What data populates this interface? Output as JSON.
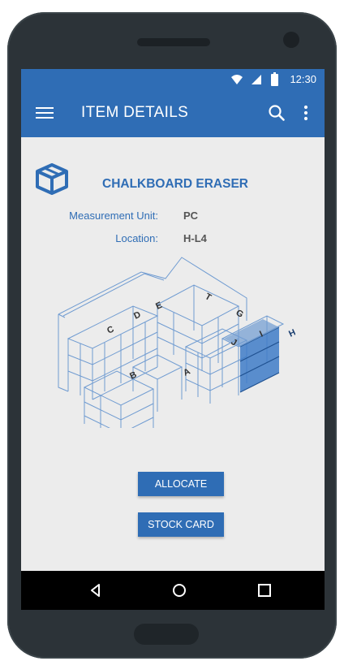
{
  "status": {
    "time": "12:30"
  },
  "appbar": {
    "title": "ITEM DETAILS"
  },
  "item": {
    "name": "CHALKBOARD ERASER",
    "fields": [
      {
        "label": "Measurement Unit:",
        "value": "PC"
      },
      {
        "label": "Location:",
        "value": "H-L4"
      }
    ],
    "shelf_labels": [
      "C",
      "D",
      "E",
      "T",
      "G",
      "I",
      "H",
      "J",
      "A",
      "B"
    ],
    "highlighted_shelf": "H"
  },
  "actions": {
    "allocate_label": "ALLOCATE",
    "stock_card_label": "STOCK CARD"
  },
  "colors": {
    "primary": "#2f6db5",
    "background": "#ececec",
    "frame": "#2c3338"
  },
  "icons": [
    "wifi-icon",
    "signal-icon",
    "battery-icon",
    "menu-icon",
    "search-icon",
    "more-vert-icon",
    "box-icon",
    "back-icon",
    "home-icon",
    "recents-icon"
  ]
}
